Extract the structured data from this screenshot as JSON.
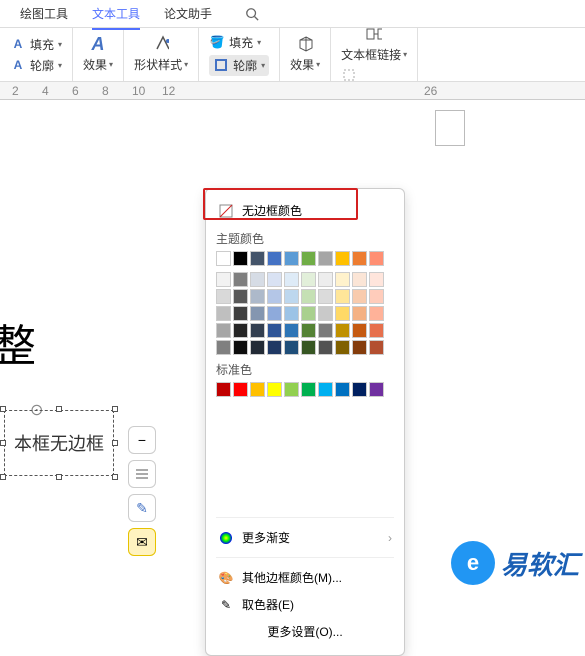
{
  "tabs": {
    "t0": "绘图工具",
    "t1": "文本工具",
    "t2": "论文助手"
  },
  "toolbar": {
    "fill": "填充",
    "outline": "轮廓",
    "effects": "效果",
    "shapeStyle": "形状样式",
    "fill2": "填充",
    "outline2": "轮廓",
    "effects2": "效果",
    "textboxLink": "文本框链接"
  },
  "ruler": {
    "m2": "2",
    "m4": "4",
    "m6": "6",
    "m8": "8",
    "m10": "10",
    "m12": "12",
    "m26": "26"
  },
  "doc": {
    "big": "整",
    "boxText": "本框无边框"
  },
  "popup": {
    "noBorder": "无边框颜色",
    "themeColors": "主题颜色",
    "stdColors": "标准色",
    "moreGrad": "更多渐变",
    "otherColor": "其他边框颜色(M)...",
    "picker": "取色器(E)",
    "moreSet": "更多设置(O)..."
  },
  "themeRow1": [
    "#ffffff",
    "#000000",
    "#44546a",
    "#4472c4",
    "#5b9bd5",
    "#70ad47",
    "#a5a5a5",
    "#ffc000",
    "#ed7d31",
    "#ff8f73"
  ],
  "themeShades": [
    [
      "#f2f2f2",
      "#7f7f7f",
      "#d6dce5",
      "#d9e2f3",
      "#deebf7",
      "#e2efda",
      "#ededed",
      "#fff2cc",
      "#fbe5d6",
      "#ffe5dc"
    ],
    [
      "#d9d9d9",
      "#595959",
      "#adb9ca",
      "#b4c6e7",
      "#bdd7ee",
      "#c5e0b4",
      "#dbdbdb",
      "#ffe699",
      "#f8cbad",
      "#ffccbb"
    ],
    [
      "#bfbfbf",
      "#404040",
      "#8496b0",
      "#8eaadb",
      "#9cc3e6",
      "#a9d08e",
      "#c9c9c9",
      "#ffd966",
      "#f4b183",
      "#ffb299"
    ],
    [
      "#a6a6a6",
      "#262626",
      "#333f50",
      "#2f5597",
      "#2e75b6",
      "#548235",
      "#7b7b7b",
      "#bf9000",
      "#c55a11",
      "#e6704d"
    ],
    [
      "#808080",
      "#0d0d0d",
      "#222a35",
      "#1f3864",
      "#1f4e79",
      "#375623",
      "#525252",
      "#806000",
      "#843c0c",
      "#b34f30"
    ]
  ],
  "stdRow": [
    "#c00000",
    "#ff0000",
    "#ffc000",
    "#ffff00",
    "#92d050",
    "#00b050",
    "#00b0f0",
    "#0070c0",
    "#002060",
    "#7030a0"
  ],
  "brand": {
    "name": "易软汇"
  }
}
